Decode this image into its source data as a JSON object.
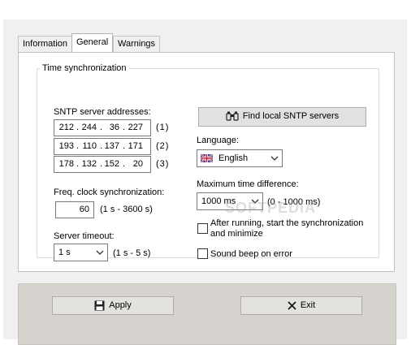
{
  "tabs": [
    {
      "label": "Information",
      "active": false
    },
    {
      "label": "General",
      "active": true
    },
    {
      "label": "Warnings",
      "active": false
    }
  ],
  "group": {
    "title": "Time synchronization"
  },
  "sntp": {
    "label": "SNTP server addresses:",
    "servers": [
      {
        "octets": [
          "212",
          "244",
          "36",
          "227"
        ],
        "index": "(1)"
      },
      {
        "octets": [
          "193",
          "110",
          "137",
          "171"
        ],
        "index": "(2)"
      },
      {
        "octets": [
          "178",
          "132",
          "152",
          "20"
        ],
        "index": "(3)"
      }
    ],
    "find_button": "Find local SNTP servers"
  },
  "freq": {
    "label": "Freq. clock synchronization:",
    "value": "60",
    "range": "(1 s - 3600 s)"
  },
  "timeout": {
    "label": "Server timeout:",
    "value": "1 s",
    "range": "(1 s - 5 s)"
  },
  "language": {
    "label": "Language:",
    "value": "English"
  },
  "maxdiff": {
    "label": "Maximum time difference:",
    "value": "1000 ms",
    "range": "(0 - 1000 ms)"
  },
  "options": {
    "after_running": "After running, start the synchronization and minimize",
    "sound_beep": "Sound beep on error",
    "after_running_checked": false,
    "sound_beep_checked": false
  },
  "buttons": {
    "apply": "Apply",
    "exit": "Exit"
  },
  "watermark": "SOFTPEDIA"
}
